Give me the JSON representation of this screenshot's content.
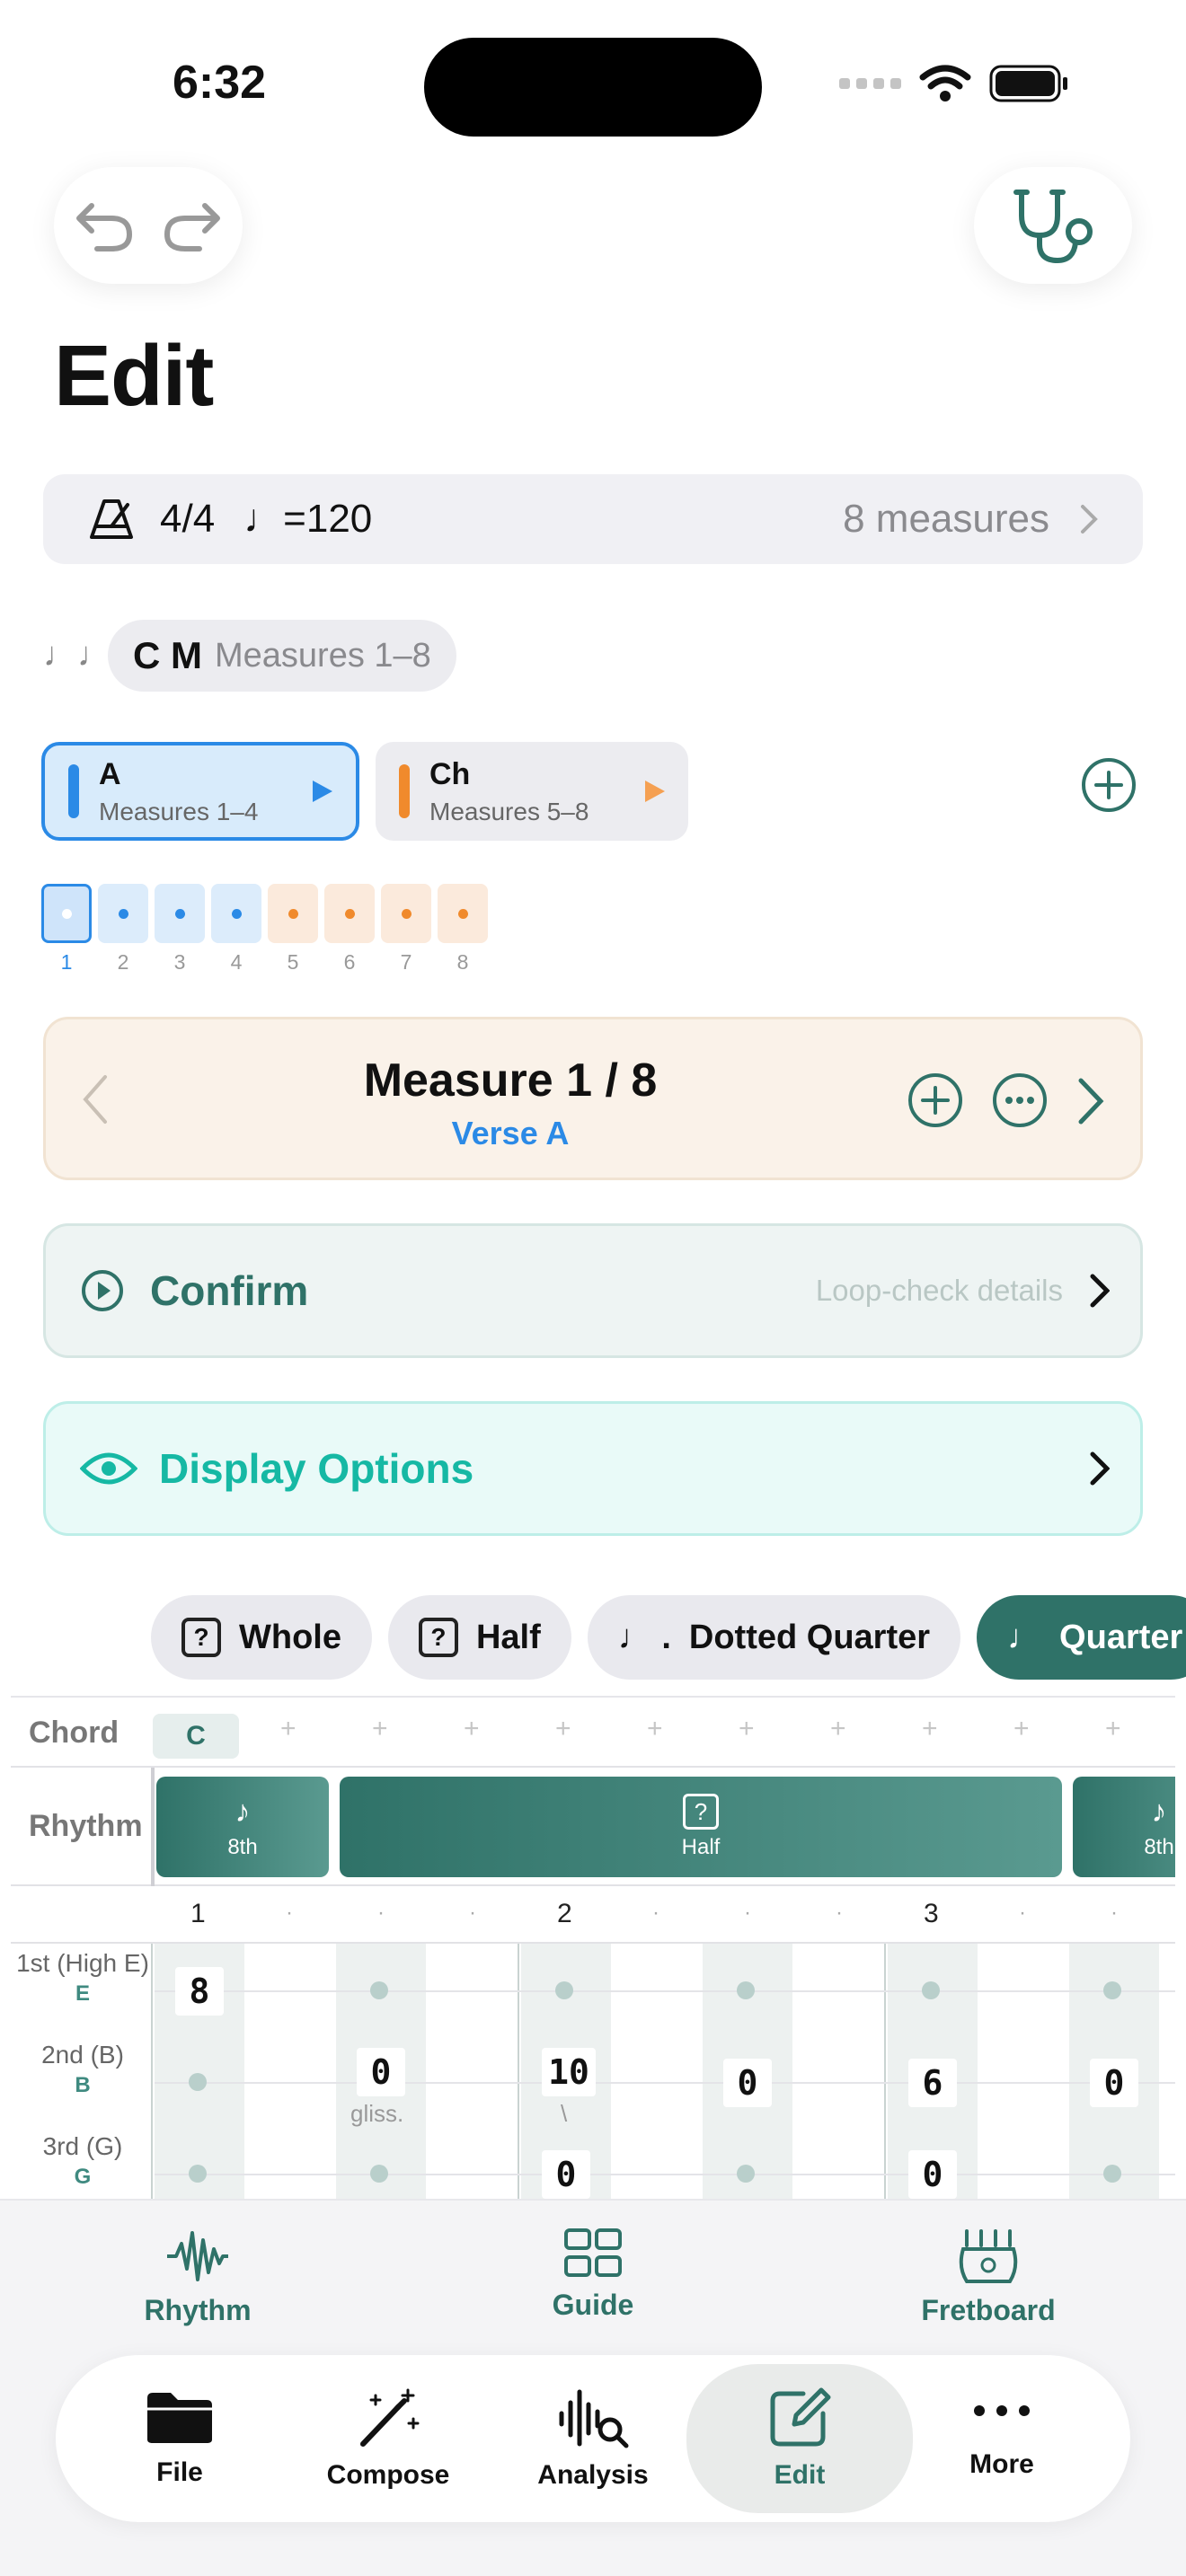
{
  "status": {
    "time": "6:32"
  },
  "page": {
    "title": "Edit"
  },
  "meta": {
    "time_signature": "4/4",
    "tempo": "=120",
    "measures": "8 measures"
  },
  "key": {
    "name": "C M",
    "range": "Measures 1–8"
  },
  "sections": [
    {
      "name": "A",
      "range": "Measures 1–4",
      "color": "#2b8ae6"
    },
    {
      "name": "Ch",
      "range": "Measures 5–8",
      "color": "#f08a2c"
    }
  ],
  "measure_dots": [
    "1",
    "2",
    "3",
    "4",
    "5",
    "6",
    "7",
    "8"
  ],
  "measure_card": {
    "title": "Measure 1 / 8",
    "subtitle": "Verse A"
  },
  "confirm": {
    "label": "Confirm",
    "hint": "Loop-check details"
  },
  "display_options": {
    "label": "Display Options"
  },
  "durations": [
    {
      "label": "Whole",
      "icon": "?"
    },
    {
      "label": "Half",
      "icon": "?"
    },
    {
      "label": "Dotted Quarter",
      "icon": "♩ ."
    },
    {
      "label": "Quarter",
      "icon": "♩"
    }
  ],
  "grid": {
    "chord_label": "Chord",
    "chord": "C",
    "plus": "+",
    "rhythm_label": "Rhythm",
    "rhythm_blocks": [
      {
        "icon": "♪",
        "label": "8th"
      },
      {
        "icon": "?",
        "label": "Half"
      },
      {
        "icon": "♪",
        "label": "8th"
      }
    ],
    "beats": [
      "1",
      "2",
      "3"
    ],
    "beat_dot": "·",
    "strings": [
      {
        "label": "1st (High E)",
        "note": "E"
      },
      {
        "label": "2nd (B)",
        "note": "B"
      },
      {
        "label": "3rd (G)",
        "note": "G"
      }
    ],
    "frets": {
      "s1c1": "8",
      "s2c3": "0",
      "s2c3_note": "gliss.",
      "s2c5": "10",
      "s2c5_note": "\\",
      "s2c7": "0",
      "s2c9": "6",
      "s2c11": "0",
      "s3c5": "0",
      "s3c9": "0"
    }
  },
  "top_nav": [
    "Rhythm",
    "Guide",
    "Fretboard"
  ],
  "tabs": [
    "File",
    "Compose",
    "Analysis",
    "Edit",
    "More"
  ]
}
